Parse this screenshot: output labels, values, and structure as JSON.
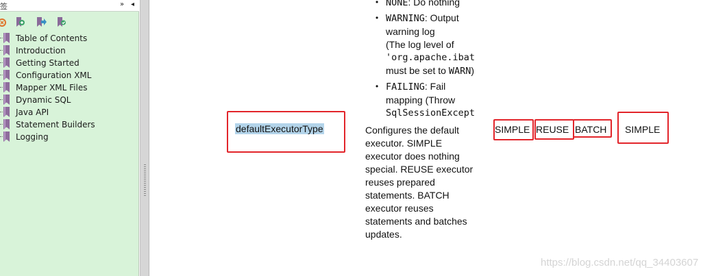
{
  "sidebar": {
    "header": {
      "title": "签",
      "collapse": "»",
      "pin": "◂"
    },
    "toolbar": [
      {
        "icon": "delete-bookmark-icon"
      },
      {
        "icon": "expand-bookmark-icon"
      },
      {
        "icon": "go-to-bookmark-icon"
      },
      {
        "icon": "find-bookmark-icon"
      }
    ],
    "bookmarks": [
      "Table of Contents",
      "Introduction",
      "Getting Started",
      "Configuration XML",
      "Mapper XML Files",
      "Dynamic SQL",
      "Java API",
      "Statement Builders",
      "Logging"
    ]
  },
  "document": {
    "bullets": [
      {
        "code": "NONE",
        "text": ": Do nothing"
      },
      {
        "code": "WARNING",
        "text": ": Output",
        "lines": [
          "warning log",
          "(The log level of"
        ],
        "code2": "'org.apache.ibat",
        "tail_pre": "must be set to ",
        "tail_code": "WARN",
        "tail_post": ")"
      },
      {
        "code": "FAILING",
        "text": ": Fail",
        "lines": [
          "mapping (Throw"
        ],
        "code2": "SqlSessionExcept"
      }
    ],
    "setting_name": "defaultExecutorType",
    "description_lines": [
      "Configures the default",
      "executor. SIMPLE",
      "executor does nothing",
      "special. REUSE executor",
      "reuses prepared",
      "statements. BATCH",
      "executor reuses",
      "statements and batches",
      "updates."
    ],
    "valid_values": [
      "SIMPLE",
      "REUSE",
      "BATCH"
    ],
    "default_value": "SIMPLE"
  },
  "watermark": "https://blog.csdn.net/qq_34403607",
  "colors": {
    "annotation": "#e2242a",
    "highlight": "#b3d4ea",
    "sidebar_bg": "#d8f3d9"
  }
}
